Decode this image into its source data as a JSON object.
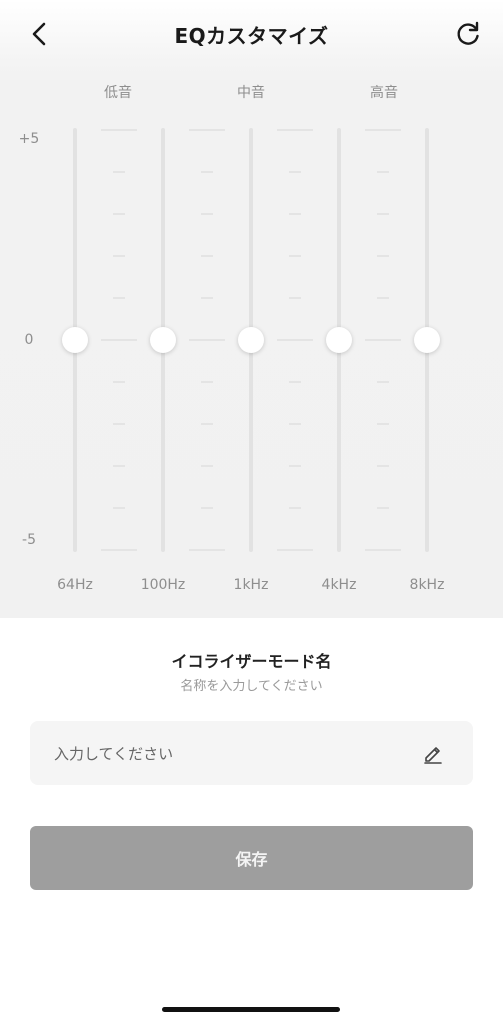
{
  "header": {
    "title": "EQカスタマイズ",
    "back_icon": "chevron-left-icon",
    "reset_icon": "refresh-icon"
  },
  "range_labels": [
    "低音",
    "中音",
    "高音"
  ],
  "axis": {
    "top": "+5",
    "middle": "0",
    "bottom": "-5"
  },
  "bands": [
    {
      "label": "64Hz",
      "value": 0
    },
    {
      "label": "100Hz",
      "value": 0
    },
    {
      "label": "1kHz",
      "value": 0
    },
    {
      "label": "4kHz",
      "value": 0
    },
    {
      "label": "8kHz",
      "value": 0
    }
  ],
  "mode": {
    "title": "イコライザーモード名",
    "subtitle": "名称を入力してください",
    "input_placeholder": "入力してください",
    "input_value": "",
    "edit_icon": "pencil-icon"
  },
  "save_label": "保存",
  "colors": {
    "save_bg": "#9e9e9e",
    "track": "#e2e2e2",
    "panel_bg": "#f1f1f1"
  }
}
